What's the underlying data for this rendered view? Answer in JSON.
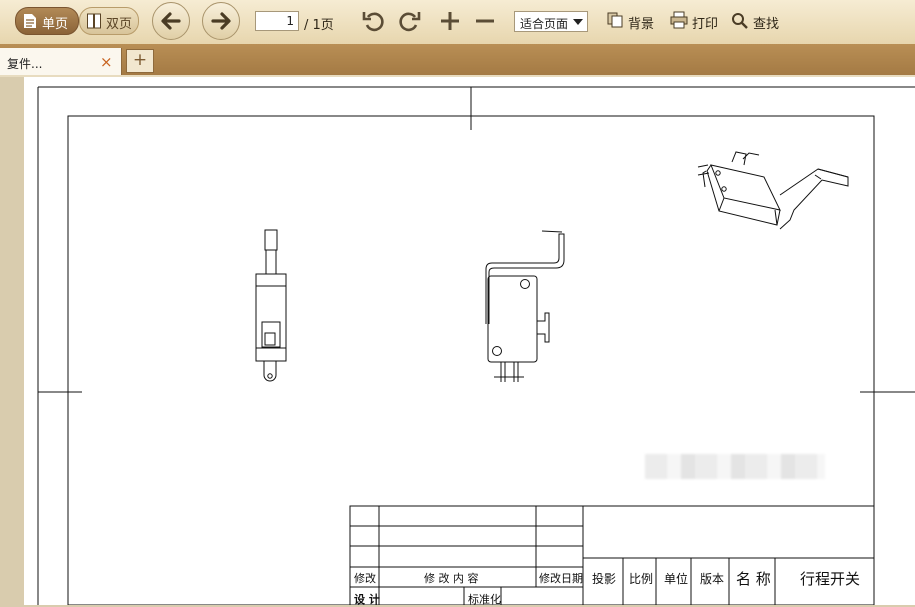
{
  "toolbar": {
    "single_page": "单页",
    "double_page": "双页",
    "page_current": "1",
    "page_total": "/ 1页",
    "zoom_value": "适合页面",
    "background": "背景",
    "print": "打印",
    "find": "查找"
  },
  "tabs": {
    "active_label": "复件...",
    "close_glyph": "×",
    "add_glyph": "+"
  },
  "drawing": {
    "headers": {
      "modify": "修改",
      "modify_content": "修 改 内 容",
      "modify_date": "修改日期",
      "projection": "投影",
      "scale": "比例",
      "unit": "单位",
      "version": "版本",
      "name": "名 称",
      "title": "行程开关",
      "design": "设 计",
      "standardize": "标准化"
    }
  },
  "colors": {
    "toolbar_bg": "#ecdcb7",
    "tab_strip": "#b08550",
    "accent_close": "#c8621e",
    "line": "#111111"
  }
}
